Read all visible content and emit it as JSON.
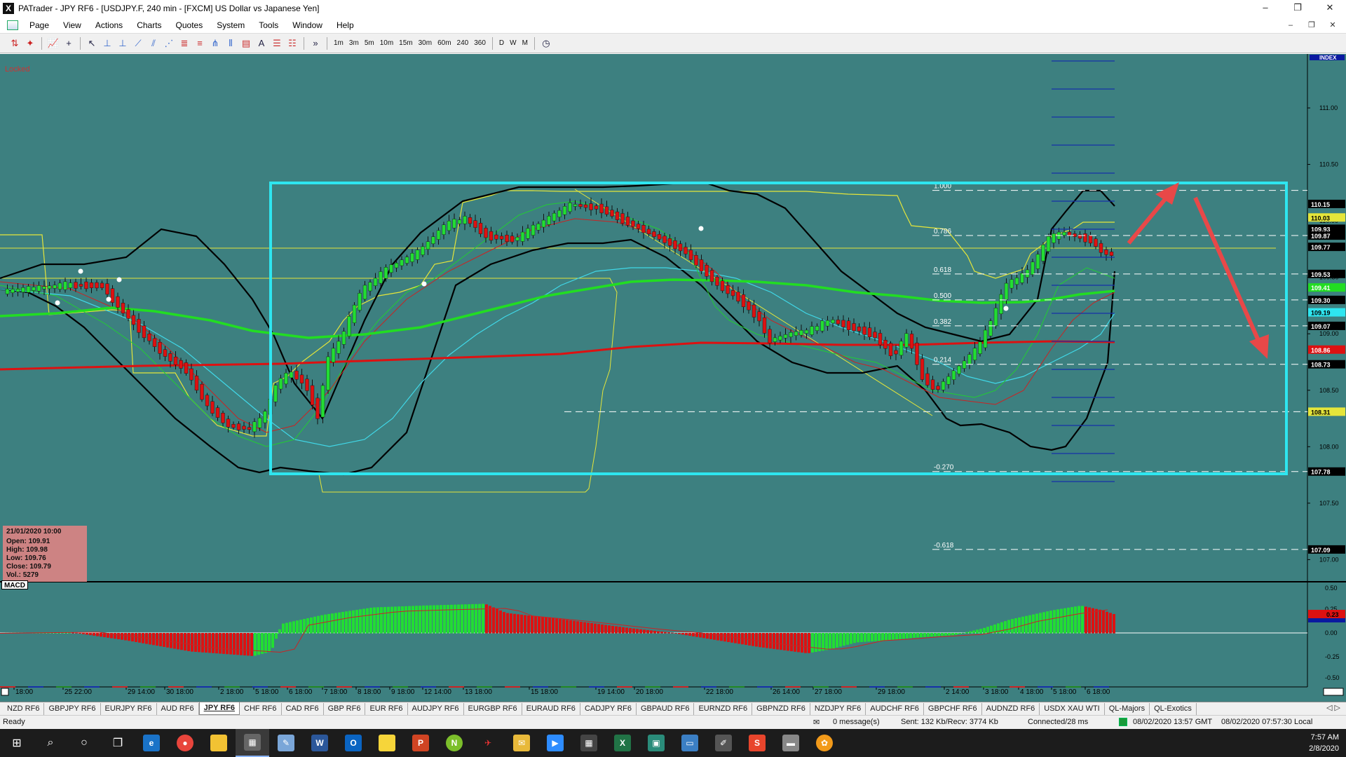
{
  "title": "PATrader - JPY RF6 - [USDJPY.F, 240 min - [FXCM] US Dollar vs Japanese Yen]",
  "window_controls": [
    "–",
    "❐",
    "✕"
  ],
  "menu": [
    "Page",
    "View",
    "Actions",
    "Charts",
    "Quotes",
    "System",
    "Tools",
    "Window",
    "Help"
  ],
  "mdi_controls": [
    "–",
    "❐",
    "✕"
  ],
  "toolbar": {
    "timeframes": [
      "1m",
      "3m",
      "5m",
      "10m",
      "15m",
      "30m",
      "60m",
      "240",
      "360"
    ],
    "periods": [
      "D",
      "W",
      "M"
    ],
    "more": "»"
  },
  "chart": {
    "locked_label": "Locked",
    "index_label": "INDEX",
    "macd_label": "MACD",
    "colors": {
      "background": "#3d8080",
      "bull": "#22dd33",
      "bear": "#dd1111",
      "sma_red": "#dd1111",
      "sma_green": "#22dd22",
      "bollinger": "#000000",
      "envelope": "#e5e53a",
      "rect": "#2ee6f0"
    },
    "info": {
      "date": "21/01/2020 10:00",
      "open": "Open: 109.91",
      "high": "High: 109.98",
      "low": "Low: 109.76",
      "close": "Close: 109.79",
      "vol": "Vol.: 5279"
    },
    "price_axis": [
      "111.00",
      "110.50",
      "110.00",
      "109.50",
      "109.00",
      "108.50",
      "108.00",
      "107.50",
      "107.00"
    ],
    "price_markers": [
      {
        "label": "110.15",
        "bg": "#000000",
        "fg": "#ffffff",
        "price": 110.15
      },
      {
        "label": "110.03",
        "bg": "#e5e53a",
        "fg": "#000000",
        "price": 110.03
      },
      {
        "label": "109.93",
        "bg": "#000000",
        "fg": "#ffffff",
        "price": 109.93
      },
      {
        "label": "109.87",
        "bg": "#000000",
        "fg": "#ffffff",
        "price": 109.87
      },
      {
        "label": "109.77",
        "bg": "#000000",
        "fg": "#ffffff",
        "price": 109.77
      },
      {
        "label": "109.53",
        "bg": "#000000",
        "fg": "#ffffff",
        "price": 109.53
      },
      {
        "label": "109.41",
        "bg": "#22dd22",
        "fg": "#ffffff",
        "price": 109.41
      },
      {
        "label": "109.30",
        "bg": "#000000",
        "fg": "#ffffff",
        "price": 109.3
      },
      {
        "label": "109.19",
        "bg": "#2ee6f0",
        "fg": "#000000",
        "price": 109.19
      },
      {
        "label": "109.07",
        "bg": "#000000",
        "fg": "#ffffff",
        "price": 109.07
      },
      {
        "label": "108.86",
        "bg": "#dd1111",
        "fg": "#ffffff",
        "price": 108.86
      },
      {
        "label": "108.73",
        "bg": "#000000",
        "fg": "#ffffff",
        "price": 108.73
      },
      {
        "label": "108.31",
        "bg": "#e5e53a",
        "fg": "#000000",
        "price": 108.31
      },
      {
        "label": "107.78",
        "bg": "#000000",
        "fg": "#ffffff",
        "price": 107.78
      },
      {
        "label": "107.09",
        "bg": "#000000",
        "fg": "#ffffff",
        "price": 107.09
      }
    ],
    "fib_levels": [
      {
        "label": "1.000",
        "price": 110.27
      },
      {
        "label": "0.786",
        "price": 109.87
      },
      {
        "label": "0.618",
        "price": 109.53
      },
      {
        "label": "0.500",
        "price": 109.3
      },
      {
        "label": "0.382",
        "price": 109.07
      },
      {
        "label": "0.214",
        "price": 108.73
      },
      {
        "label": "-0.270",
        "price": 107.78
      },
      {
        "label": "-0.618",
        "price": 107.09
      }
    ],
    "macd_axis": [
      "0.50",
      "0.25",
      "0.00",
      "-0.25",
      "-0.50"
    ],
    "macd_marker": "0.23",
    "time_labels": [
      "18:00",
      "25 22:00",
      "29 14:00",
      "30 18:00",
      "2 18:00",
      "5 18:00",
      "6 18:00",
      "7 18:00",
      "8 18:00",
      "9 18:00",
      "12 14:00",
      "13 18:00",
      "15 18:00",
      "19 14:00",
      "20 18:00",
      "22 18:00",
      "26 14:00",
      "27 18:00",
      "29 18:00",
      "2 14:00",
      "3 18:00",
      "4 18:00",
      "5 18:00",
      "6 18:00"
    ]
  },
  "symbol_tabs": [
    "NZD RF6",
    "GBPJPY RF6",
    "EURJPY RF6",
    "AUD RF6",
    "JPY RF6",
    "CHF RF6",
    "CAD RF6",
    "GBP RF6",
    "EUR RF6",
    "AUDJPY RF6",
    "EURGBP RF6",
    "EURAUD RF6",
    "CADJPY RF6",
    "GBPAUD RF6",
    "EURNZD RF6",
    "GBPNZD RF6",
    "NZDJPY RF6",
    "AUDCHF RF6",
    "GBPCHF RF6",
    "AUDNZD RF6",
    "USDX XAU WTI",
    "QL-Majors",
    "QL-Exotics"
  ],
  "active_tab": "JPY RF6",
  "status": {
    "ready": "Ready",
    "messages": "0 message(s)",
    "traffic": "Sent: 132 Kb/Recv: 3774 Kb",
    "connection": "Connected/28 ms",
    "gmt": "08/02/2020 13:57 GMT",
    "local": "08/02/2020 07:57:30 Local"
  },
  "taskbar": {
    "time": "7:57 AM",
    "date": "2/8/2020"
  }
}
